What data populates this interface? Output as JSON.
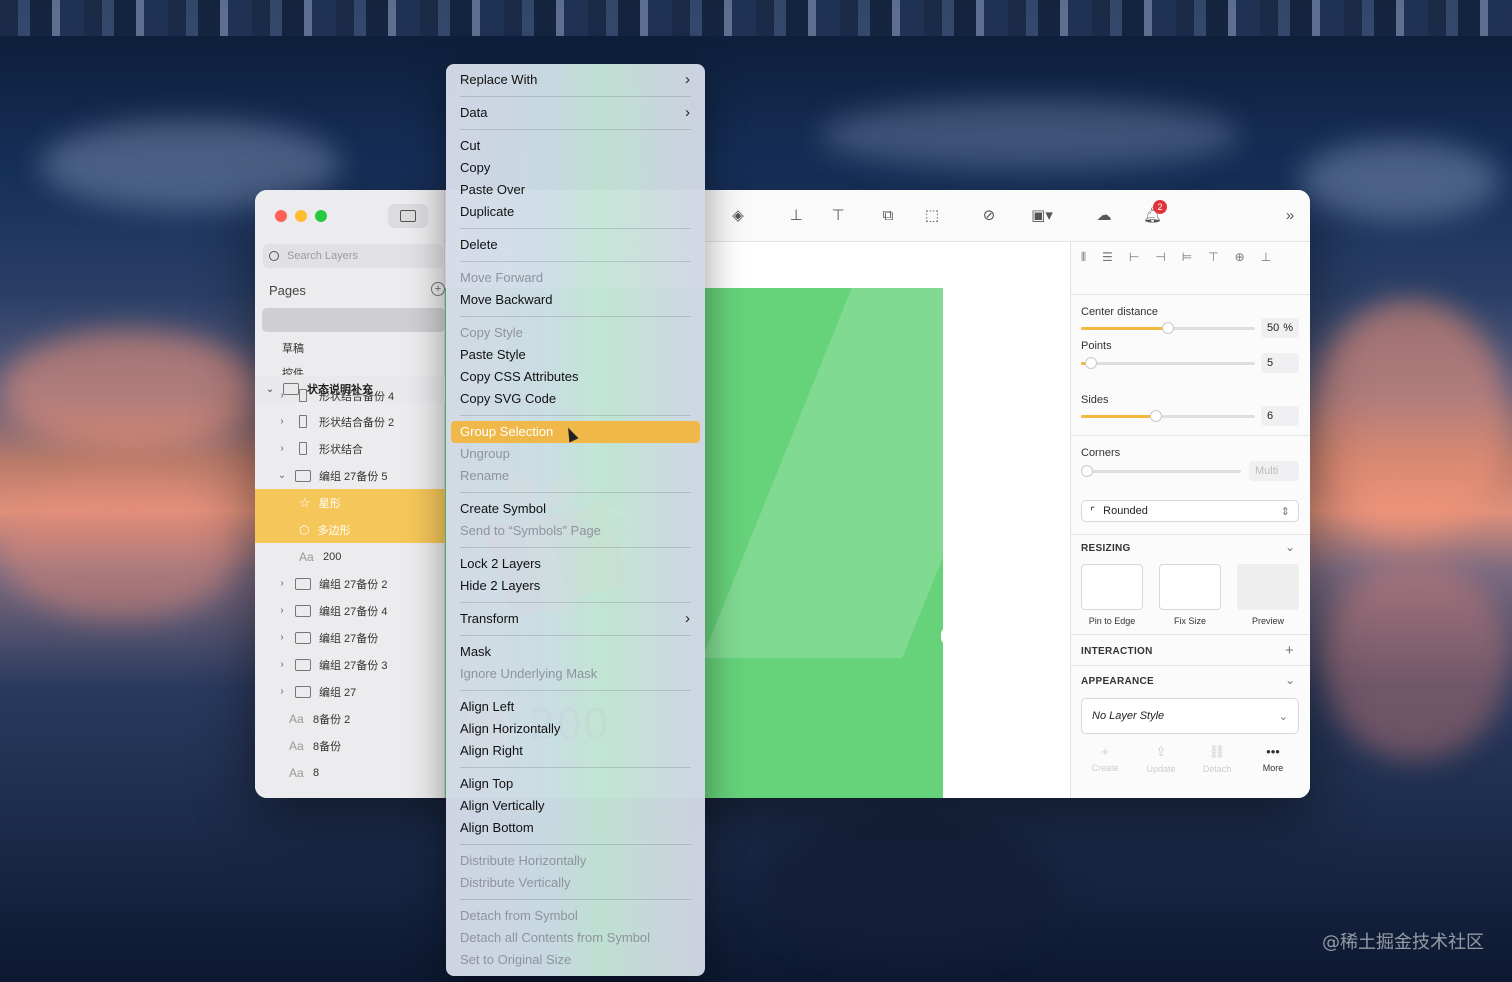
{
  "watermark": "@稀土掘金技术社区",
  "sidebar": {
    "search_placeholder": "Search Layers",
    "pages_label": "Pages",
    "pages": [
      "草稿",
      "控件"
    ],
    "layer_group": "状态说明补充",
    "layers": [
      {
        "name": "形状结合备份 4",
        "kind": "shape",
        "chevron": "›",
        "selected": false
      },
      {
        "name": "形状结合备份 2",
        "kind": "shape",
        "chevron": "›",
        "selected": false
      },
      {
        "name": "形状结合",
        "kind": "shape",
        "chevron": "›",
        "selected": false
      },
      {
        "name": "编组 27备份 5",
        "kind": "folder",
        "chevron": "⌄",
        "selected": false
      },
      {
        "name": "星形",
        "kind": "star",
        "chevron": "",
        "selected": true
      },
      {
        "name": "多边形",
        "kind": "polygon",
        "chevron": "",
        "selected": true
      },
      {
        "name": "200",
        "kind": "text",
        "chevron": "",
        "selected": false
      },
      {
        "name": "编组 27备份 2",
        "kind": "folder",
        "chevron": "›",
        "selected": false
      },
      {
        "name": "编组 27备份 4",
        "kind": "folder",
        "chevron": "›",
        "selected": false
      },
      {
        "name": "编组 27备份",
        "kind": "folder",
        "chevron": "›",
        "selected": false
      },
      {
        "name": "编组 27备份 3",
        "kind": "folder",
        "chevron": "›",
        "selected": false
      },
      {
        "name": "编组 27",
        "kind": "folder",
        "chevron": "›",
        "selected": false
      },
      {
        "name": "8备份 2",
        "kind": "text",
        "chevron": "",
        "selected": false
      },
      {
        "name": "8备份",
        "kind": "text",
        "chevron": "",
        "selected": false
      },
      {
        "name": "8",
        "kind": "text",
        "chevron": "",
        "selected": false
      }
    ]
  },
  "toolbar": {
    "notification_count": "2"
  },
  "canvas": {
    "score_text": "200",
    "artboard_color": "#66d27a"
  },
  "inspector": {
    "center_distance_label": "Center distance",
    "center_distance_value": "50",
    "center_distance_unit": "%",
    "center_distance_fraction": 0.5,
    "points_label": "Points",
    "points_value": "5",
    "sides_label": "Sides",
    "sides_value": "6",
    "corners_label": "Corners",
    "corners_value": "Multi",
    "corner_style": "Rounded",
    "resizing_title": "RESIZING",
    "resize_options": [
      "Pin to Edge",
      "Fix Size",
      "Preview"
    ],
    "interaction_title": "INTERACTION",
    "appearance_title": "APPEARANCE",
    "layer_style": "No Layer Style",
    "style_actions": [
      "Create",
      "Update",
      "Detach",
      "More"
    ]
  },
  "context_menu": {
    "accent": "#efb848",
    "groups": [
      [
        {
          "label": "Replace With",
          "submenu": true
        }
      ],
      [
        {
          "label": "Data",
          "submenu": true
        }
      ],
      [
        {
          "label": "Cut"
        },
        {
          "label": "Copy"
        },
        {
          "label": "Paste Over"
        },
        {
          "label": "Duplicate"
        }
      ],
      [
        {
          "label": "Delete"
        }
      ],
      [
        {
          "label": "Move Forward",
          "disabled": true
        },
        {
          "label": "Move Backward"
        }
      ],
      [
        {
          "label": "Copy Style",
          "disabled": true
        },
        {
          "label": "Paste Style"
        },
        {
          "label": "Copy CSS Attributes"
        },
        {
          "label": "Copy SVG Code"
        }
      ],
      [
        {
          "label": "Group Selection",
          "highlighted": true
        },
        {
          "label": "Ungroup",
          "disabled": true
        },
        {
          "label": "Rename",
          "disabled": true
        }
      ],
      [
        {
          "label": "Create Symbol"
        },
        {
          "label": "Send to “Symbols” Page",
          "disabled": true
        }
      ],
      [
        {
          "label": "Lock 2 Layers"
        },
        {
          "label": "Hide 2 Layers"
        }
      ],
      [
        {
          "label": "Transform",
          "submenu": true
        }
      ],
      [
        {
          "label": "Mask"
        },
        {
          "label": "Ignore Underlying Mask",
          "disabled": true
        }
      ],
      [
        {
          "label": "Align Left"
        },
        {
          "label": "Align Horizontally"
        },
        {
          "label": "Align Right"
        }
      ],
      [
        {
          "label": "Align Top"
        },
        {
          "label": "Align Vertically"
        },
        {
          "label": "Align Bottom"
        }
      ],
      [
        {
          "label": "Distribute Horizontally",
          "disabled": true
        },
        {
          "label": "Distribute Vertically",
          "disabled": true
        }
      ],
      [
        {
          "label": "Detach from Symbol",
          "disabled": true
        },
        {
          "label": "Detach all Contents from Symbol",
          "disabled": true
        },
        {
          "label": "Set to Original Size",
          "disabled": true
        }
      ]
    ]
  }
}
